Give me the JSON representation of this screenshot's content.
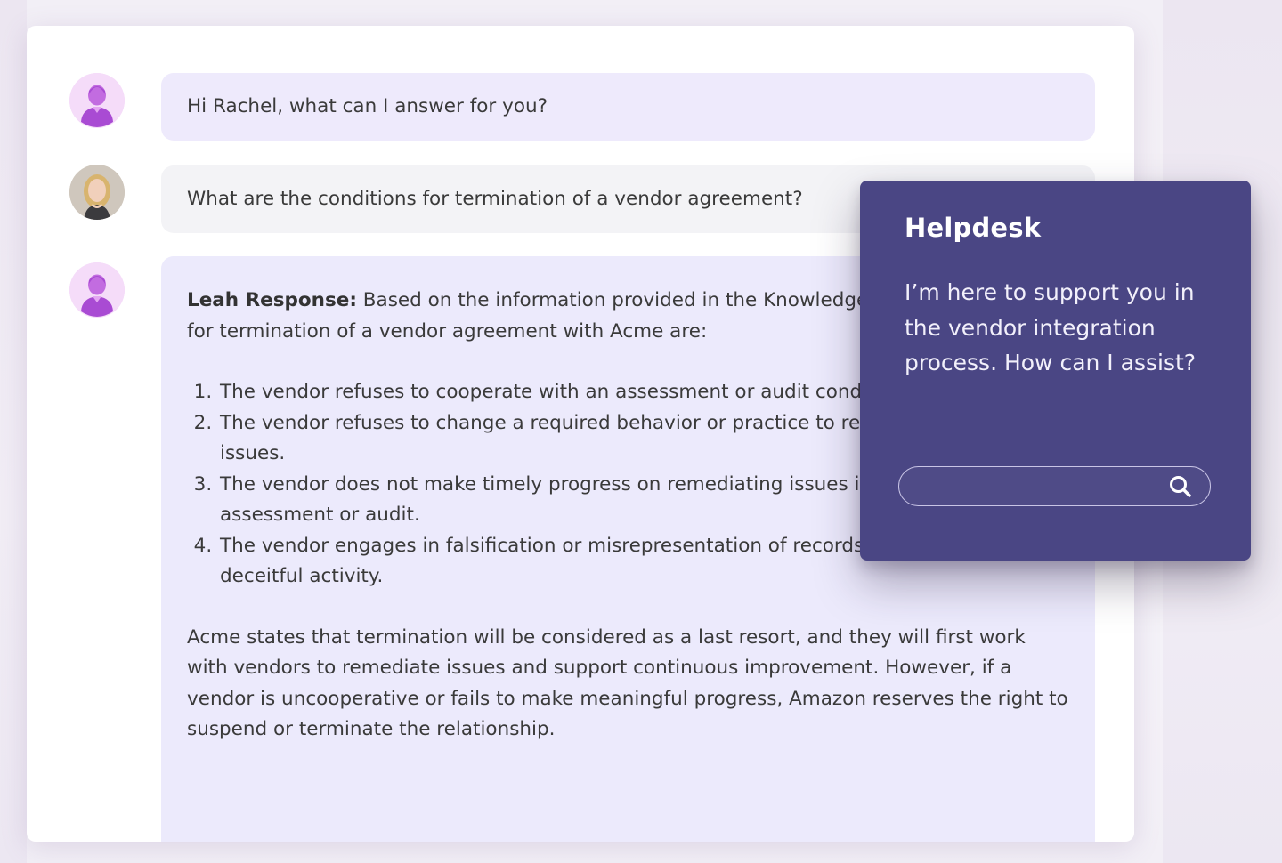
{
  "chat": {
    "greeting": "Hi Rachel, what can I answer for you?",
    "question": "What are the conditions for termination of a vendor agreement?",
    "answer": {
      "label": "Leah Response:",
      "intro": " Based on the information provided in the Knowledge Base, the conditions for termination of a vendor agreement with Acme are:",
      "items": [
        "The vendor refuses to cooperate with an assessment or audit conducted by Acme.",
        "The vendor refuses to change a required behavior or practice to remediate identified issues.",
        "The vendor does not make timely progress on remediating issues identified during an assessment or audit.",
        "The vendor engages in falsification or misrepresentation of records or other illegal or deceitful activity."
      ],
      "closing": "Acme states that termination will be considered as a last resort, and they will first work with vendors to remediate issues and support continuous improvement. However, if a vendor is uncooperative or fails to make meaningful progress, Amazon reserves the right to suspend or terminate the relationship."
    }
  },
  "helpdesk": {
    "title": "Helpdesk",
    "message": "I’m here to support you in the vendor integration process.  How can I assist?",
    "search_value": "",
    "search_icon": "search-icon"
  },
  "colors": {
    "helpdesk_bg": "#4a4684",
    "bot_bubble": "#eeeafc",
    "user_bubble": "#f3f3f6",
    "bot_avatar": "#b84fd8"
  }
}
